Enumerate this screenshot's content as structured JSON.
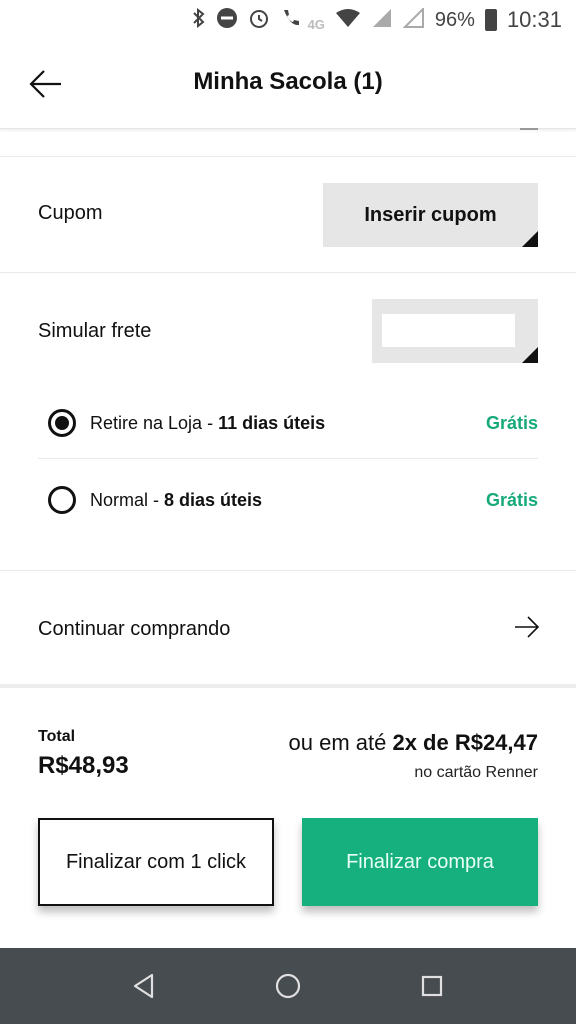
{
  "status_bar": {
    "network_label": "4G",
    "battery": "96%",
    "time": "10:31",
    "icons": [
      "bluetooth-icon",
      "do-not-disturb-icon",
      "alarm-icon",
      "volte-call-icon",
      "wifi-icon",
      "signal-icon",
      "signal-empty-icon",
      "battery-icon"
    ]
  },
  "header": {
    "title": "Minha Sacola (1)",
    "back_icon": "arrow-left-icon"
  },
  "coupon": {
    "label": "Cupom",
    "button_label": "Inserir cupom"
  },
  "shipping": {
    "label": "Simular frete",
    "cep_value": "",
    "options": [
      {
        "name": "Retire na Loja",
        "separator": " - ",
        "deadline": "11 dias úteis",
        "price": "Grátis",
        "selected": true
      },
      {
        "name": "Normal",
        "separator": " - ",
        "deadline": "8 dias úteis",
        "price": "Grátis",
        "selected": false
      }
    ]
  },
  "continue": {
    "label": "Continuar comprando",
    "icon": "arrow-right-icon"
  },
  "summary": {
    "total_label": "Total",
    "total_value": "R$48,93",
    "installment_prefix": "ou em até ",
    "installment_value": "2x de R$24,47",
    "installment_note": "no cartão Renner"
  },
  "actions": {
    "one_click_label": "Finalizar com 1 click",
    "checkout_label": "Finalizar compra"
  },
  "colors": {
    "accent_green": "#16b07e",
    "price_green": "#16a97a",
    "nav_bg": "#474c51"
  },
  "nav": [
    "back-nav-icon",
    "home-nav-icon",
    "recents-nav-icon"
  ]
}
